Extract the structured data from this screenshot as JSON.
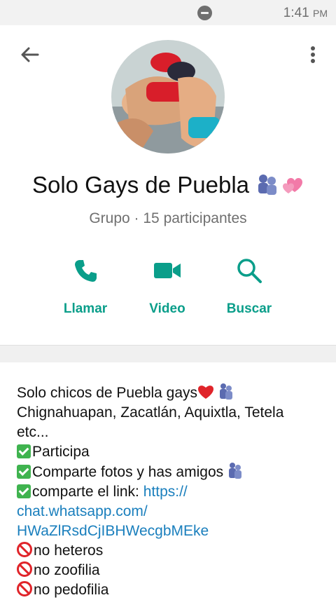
{
  "status_bar": {
    "time": "1:41",
    "ampm": "PM"
  },
  "header": {
    "back_icon": "arrow-left-icon",
    "menu_icon": "more-vert-icon"
  },
  "group": {
    "name": "Solo Gays de Puebla",
    "meta": "Grupo · 15 participantes"
  },
  "actions": [
    {
      "label": "Llamar",
      "icon": "phone-icon"
    },
    {
      "label": "Video",
      "icon": "video-icon"
    },
    {
      "label": "Buscar",
      "icon": "search-icon"
    }
  ],
  "description": {
    "line1": "Solo chicos de Puebla gays",
    "line2": "Chignahuapan, Zacatlán, Aquixtla, Tetela",
    "line3": "etc...",
    "line4": "Participa",
    "line5": "Comparte fotos y has amigos",
    "line6_text": "comparte el link: ",
    "line6_link": "https://",
    "line7_link": "chat.whatsapp.com/",
    "line8_link": "HWaZlRsdCjIBHWecgbMEke",
    "line9": "no heteros",
    "line10": "no zoofilia",
    "line11": "no pedofilia"
  },
  "colors": {
    "accent": "#0a9e8a",
    "link": "#1a7fbd",
    "no_sign": "#e0242a",
    "check": "#3fb34f"
  }
}
